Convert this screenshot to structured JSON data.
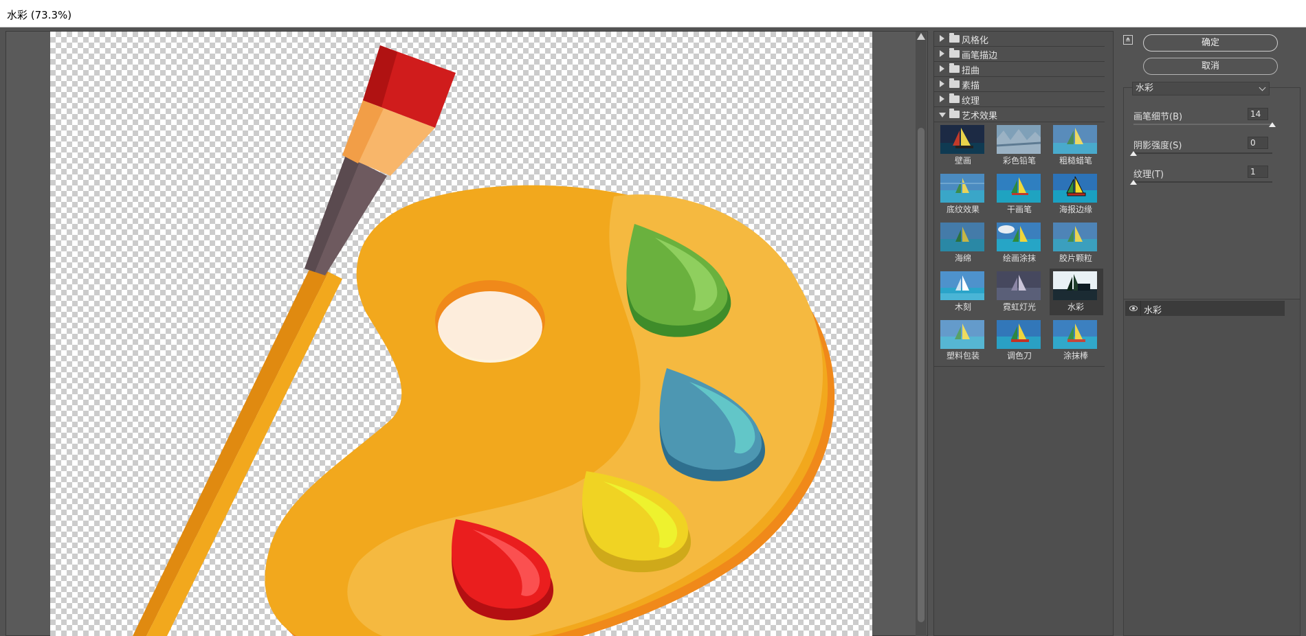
{
  "window": {
    "title": "水彩 (73.3%)"
  },
  "filter_categories": [
    {
      "label": "风格化",
      "expanded": false
    },
    {
      "label": "画笔描边",
      "expanded": false
    },
    {
      "label": "扭曲",
      "expanded": false
    },
    {
      "label": "素描",
      "expanded": false
    },
    {
      "label": "纹理",
      "expanded": false
    },
    {
      "label": "艺术效果",
      "expanded": true
    }
  ],
  "artistic_filters": [
    {
      "label": "壁画",
      "icon": "fresco-thumbnail"
    },
    {
      "label": "彩色铅笔",
      "icon": "colored-pencil-thumbnail"
    },
    {
      "label": "粗糙蜡笔",
      "icon": "rough-pastels-thumbnail"
    },
    {
      "label": "底纹效果",
      "icon": "underpainting-thumbnail"
    },
    {
      "label": "干画笔",
      "icon": "dry-brush-thumbnail"
    },
    {
      "label": "海报边缘",
      "icon": "poster-edges-thumbnail"
    },
    {
      "label": "海绵",
      "icon": "sponge-thumbnail"
    },
    {
      "label": "绘画涂抹",
      "icon": "paint-daubs-thumbnail"
    },
    {
      "label": "胶片颗粒",
      "icon": "film-grain-thumbnail"
    },
    {
      "label": "木刻",
      "icon": "cutout-thumbnail"
    },
    {
      "label": "霓虹灯光",
      "icon": "neon-glow-thumbnail"
    },
    {
      "label": "水彩",
      "icon": "watercolor-thumbnail",
      "selected": true
    },
    {
      "label": "塑料包装",
      "icon": "plastic-wrap-thumbnail"
    },
    {
      "label": "调色刀",
      "icon": "palette-knife-thumbnail"
    },
    {
      "label": "涂抹棒",
      "icon": "smudge-stick-thumbnail"
    }
  ],
  "buttons": {
    "ok": "确定",
    "cancel": "取消"
  },
  "settings": {
    "selected_filter": "水彩",
    "params": [
      {
        "label": "画笔细节(B)",
        "value": "14",
        "fraction": 1.0
      },
      {
        "label": "阴影强度(S)",
        "value": "0",
        "fraction": 0.0
      },
      {
        "label": "纹理(T)",
        "value": "1",
        "fraction": 0.0
      }
    ]
  },
  "applied_layers": [
    {
      "label": "水彩",
      "visible": true
    }
  ],
  "colors": {
    "panel_bg": "#535353",
    "palette_orange": "#f2a81d",
    "accent_red": "#d01c1c"
  }
}
